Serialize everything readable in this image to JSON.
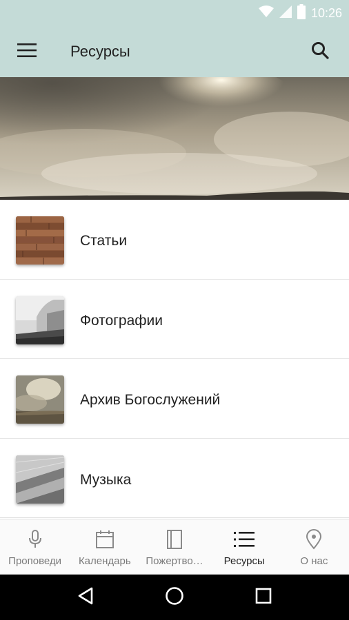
{
  "status_bar": {
    "time": "10:26",
    "icons": [
      "wifi-icon",
      "signal-icon",
      "battery-icon"
    ]
  },
  "app_bar": {
    "title": "Ресурсы",
    "menu_icon": "hamburger-menu-icon",
    "search_icon": "search-icon"
  },
  "list": {
    "items": [
      {
        "label": "Статьи",
        "thumb": "wood-texture"
      },
      {
        "label": "Фотографии",
        "thumb": "architecture-photo"
      },
      {
        "label": "Архив Богослужений",
        "thumb": "sky-landscape"
      },
      {
        "label": "Музыка",
        "thumb": "stairs-photo"
      }
    ]
  },
  "bottom_nav": {
    "items": [
      {
        "label": "Проповеди",
        "icon": "microphone-icon",
        "active": false
      },
      {
        "label": "Календарь",
        "icon": "calendar-icon",
        "active": false
      },
      {
        "label": "Пожертво…",
        "icon": "book-icon",
        "active": false
      },
      {
        "label": "Ресурсы",
        "icon": "list-icon",
        "active": true
      },
      {
        "label": "О нас",
        "icon": "location-pin-icon",
        "active": false
      }
    ]
  },
  "system_nav": {
    "icons": [
      "back-icon",
      "home-icon",
      "recents-icon"
    ]
  },
  "colors": {
    "app_bar": "#c4dbd7",
    "nav_text": "#7a7a7a",
    "active_text": "#222222"
  }
}
